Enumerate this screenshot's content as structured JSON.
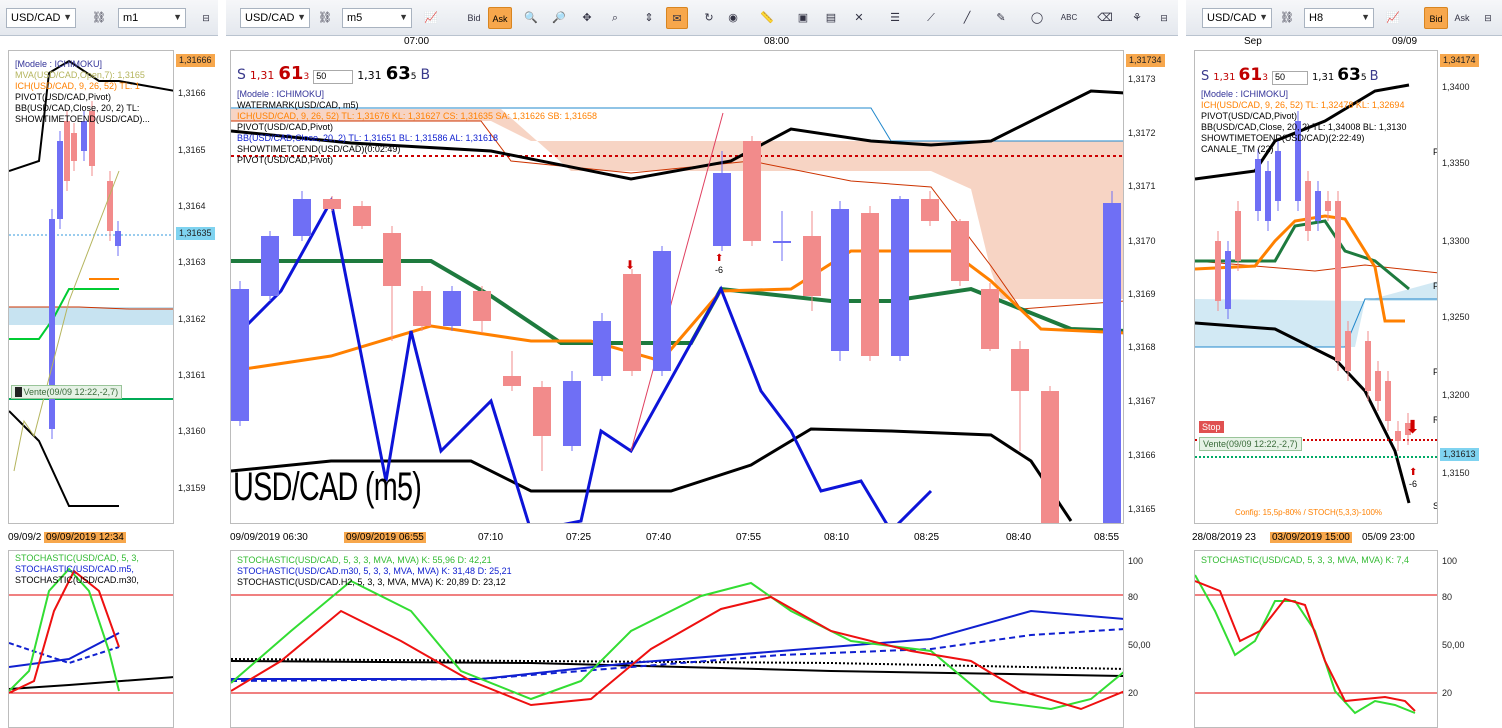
{
  "left": {
    "symbol": "USD/CAD",
    "timeframe": "m1",
    "price_badge_top": "1,31666",
    "price_badge_mid": "1,31635",
    "y_ticks": [
      "1,3166",
      "1,3165",
      "1,3164",
      "1,3163",
      "1,3162",
      "1,3161",
      "1,3160",
      "1,3159"
    ],
    "indicators": [
      "[Modele : ICHIMOKU]",
      "MVA(USD/CAD,Open,7): 1,3165",
      "ICH(USD/CAD, 9, 26, 52)  TL: 1",
      "PIVOT(USD/CAD,Pivot)",
      "BB(USD/CAD,Close, 20, 2)  TL:",
      "SHOWTIMETOEND(USD/CAD)..."
    ],
    "order_label": "Vente(09/09 12:22,-2,7)",
    "x_labels": [
      "09/09/2",
      "09/09/2019 12:34"
    ],
    "stoch_labels": [
      "STOCHASTIC(USD/CAD, 5, 3,",
      "STOCHASTIC(USD/CAD.m5,",
      "STOCHASTIC(USD/CAD.m30,"
    ]
  },
  "center": {
    "symbol": "USD/CAD",
    "timeframe": "m5",
    "bid_label": "Bid",
    "ask_label": "Ask",
    "time_top": [
      "07:00",
      "08:00"
    ],
    "sell_letter": "S",
    "sell_prefix": "1,31",
    "sell_big": "61",
    "sell_sup": "3",
    "qty": "50",
    "buy_prefix": "1,31",
    "buy_big": "63",
    "buy_sup": "5",
    "buy_letter": "B",
    "indicators": [
      "[Modele : ICHIMOKU]",
      "WATERMARK(USD/CAD, m5)",
      "ICH(USD/CAD, 9, 26, 52)  TL: 1,31676  KL: 1,31627  CS: 1,31635  SA: 1,31626  SB: 1,31658",
      "PIVOT(USD/CAD,Pivot)",
      "BB(USD/CAD,Close, 20, 2)  TL: 1,31651  BL: 1,31586  AL: 1,31618",
      "SHOWTIMETOEND(USD/CAD)(0:02:49)",
      "PIVOT(USD/CAD,Pivot)"
    ],
    "watermark": "USD/CAD (m5)",
    "price_badge_top": "1,31734",
    "y_ticks": [
      "1,3173",
      "1,3172",
      "1,3171",
      "1,3170",
      "1,3169",
      "1,3168",
      "1,3167",
      "1,3166",
      "1,3165"
    ],
    "arrow_label": "-6",
    "x_labels": [
      "09/09/2019 06:30",
      "09/09/2019 06:55",
      "07:10",
      "07:25",
      "07:40",
      "07:55",
      "08:10",
      "08:25",
      "08:40",
      "08:55"
    ],
    "stoch_labels": [
      "STOCHASTIC(USD/CAD, 5, 3, 3, MVA, MVA)  K: 55,96  D: 42,21",
      "STOCHASTIC(USD/CAD.m30, 5, 3, 3, MVA, MVA)  K: 31,48  D: 25,21",
      "STOCHASTIC(USD/CAD.H2, 5, 3, 3, MVA, MVA)  K: 20,89  D: 23,12"
    ],
    "osc_ticks": [
      "100",
      "80",
      "50,00",
      "20"
    ]
  },
  "right": {
    "symbol": "USD/CAD",
    "timeframe": "H8",
    "bid_label": "Bid",
    "ask_label": "Ask",
    "time_top": [
      "Sep",
      "09/09"
    ],
    "sell_letter": "S",
    "sell_prefix": "1,31",
    "sell_big": "61",
    "sell_sup": "3",
    "qty": "50",
    "buy_prefix": "1,31",
    "buy_big": "63",
    "buy_sup": "5",
    "buy_letter": "B",
    "indicators": [
      "[Modele : ICHIMOKU]",
      "ICH(USD/CAD, 9, 26, 52)  TL: 1,32478  KL: 1,32694",
      "PIVOT(USD/CAD,Pivot)",
      "BB(USD/CAD,Close, 20, 2)  TL: 1,34008  BL: 1,3130",
      "SHOWTIMETOEND(USD/CAD)(2:22:49)",
      "CANALE_TM (22)"
    ],
    "price_badge_top": "1,34174",
    "price_badge_mid": "1,31613",
    "y_ticks": [
      "1,3400",
      "1,3350",
      "1,3300",
      "1,3250",
      "1,3200",
      "1,3150"
    ],
    "stop_label": "Stop",
    "order_label": "Vente(09/09 12:22,-2,7)",
    "arrow_label": "-6",
    "config_text": "Config: 15,5p-80% / STOCH(5,3,3)-100%",
    "pivot_letters": [
      "P",
      "P",
      "P",
      "R",
      "S"
    ],
    "x_labels": [
      "28/08/2019 23",
      "03/09/2019 15:00",
      "05/09 23:00"
    ],
    "stoch_labels": [
      "STOCHASTIC(USD/CAD, 5, 3, 3, MVA, MVA)  K: 7,4"
    ],
    "osc_ticks": [
      "100",
      "80",
      "50,00",
      "20"
    ]
  },
  "colors": {
    "bull": "#6f6ff5",
    "bear": "#f28b8b",
    "accent_orange": "#f7a74c",
    "tenkan": "#ff8000",
    "kijun": "#1e7a3e",
    "cloud": "#f4c5b0",
    "cloud_blue": "#c7e3f1",
    "bb": "#000000",
    "stoch_blue": "#1020d0",
    "stoch_red": "#ee1010",
    "stoch_green": "#33dd33"
  }
}
